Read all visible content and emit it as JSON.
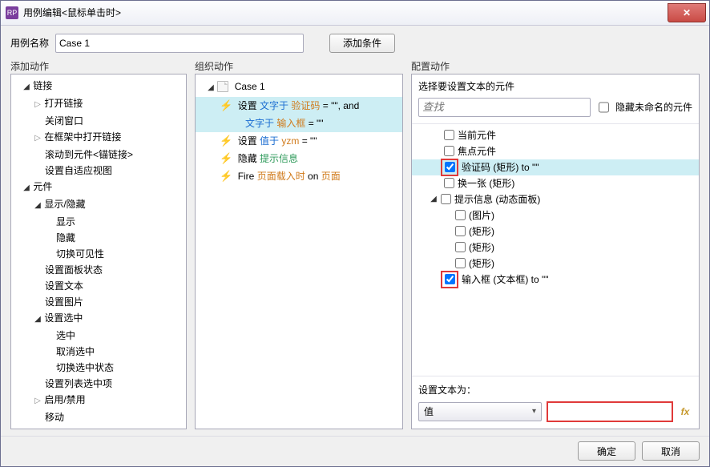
{
  "window": {
    "title": "用例编辑<鼠标单击时>"
  },
  "header": {
    "name_label": "用例名称",
    "name_value": "Case 1",
    "add_condition": "添加条件"
  },
  "columns": {
    "c1": "添加动作",
    "c2": "组织动作",
    "c3": "配置动作"
  },
  "add_actions": {
    "group_link": "链接",
    "link_open": "打开链接",
    "link_close": "关闭窗口",
    "link_frame": "在框架中打开链接",
    "link_scroll": "滚动到元件<锚链接>",
    "link_adaptive": "设置自适应视图",
    "group_widget": "元件",
    "group_showhide": "显示/隐藏",
    "show": "显示",
    "hide": "隐藏",
    "toggle_vis": "切换可见性",
    "panel_state": "设置面板状态",
    "set_text": "设置文本",
    "set_image": "设置图片",
    "group_select": "设置选中",
    "sel_on": "选中",
    "sel_off": "取消选中",
    "sel_toggle": "切换选中状态",
    "set_list_sel": "设置列表选中项",
    "group_enable": "启用/禁用",
    "move": "移动"
  },
  "case_tree": {
    "root": "Case 1",
    "a1_pre": "设置 ",
    "a1_mid": "文字于 ",
    "a1_t1": "验证码",
    "a1_eq": " = \"\", and",
    "a1b_mid": "文字于 ",
    "a1b_t2": "输入框",
    "a1b_eq": " = \"\"",
    "a2_pre": "设置 ",
    "a2_mid": "值于 ",
    "a2_t": "yzm",
    "a2_eq": " = \"\"",
    "a3_pre": "隐藏 ",
    "a3_t": "提示信息",
    "a4_pre": "Fire ",
    "a4_t1": "页面载入时",
    "a4_on": " on ",
    "a4_t2": "页面"
  },
  "configure": {
    "section": "选择要设置文本的元件",
    "search_ph": "查找",
    "hide_unnamed": "隐藏未命名的元件",
    "items": {
      "current": "当前元件",
      "focus": "焦点元件",
      "yzm": "验证码 (矩形) to \"\"",
      "next": "换一张 (矩形)",
      "tip": "提示信息 (动态面板)",
      "img": "(图片)",
      "rect1": "(矩形)",
      "rect2": "(矩形)",
      "rect3": "(矩形)",
      "input": "输入框 (文本框) to \"\""
    },
    "set_text_label": "设置文本为：",
    "value_select": "值",
    "fx": "fx"
  },
  "footer": {
    "ok": "确定",
    "cancel": "取消"
  }
}
